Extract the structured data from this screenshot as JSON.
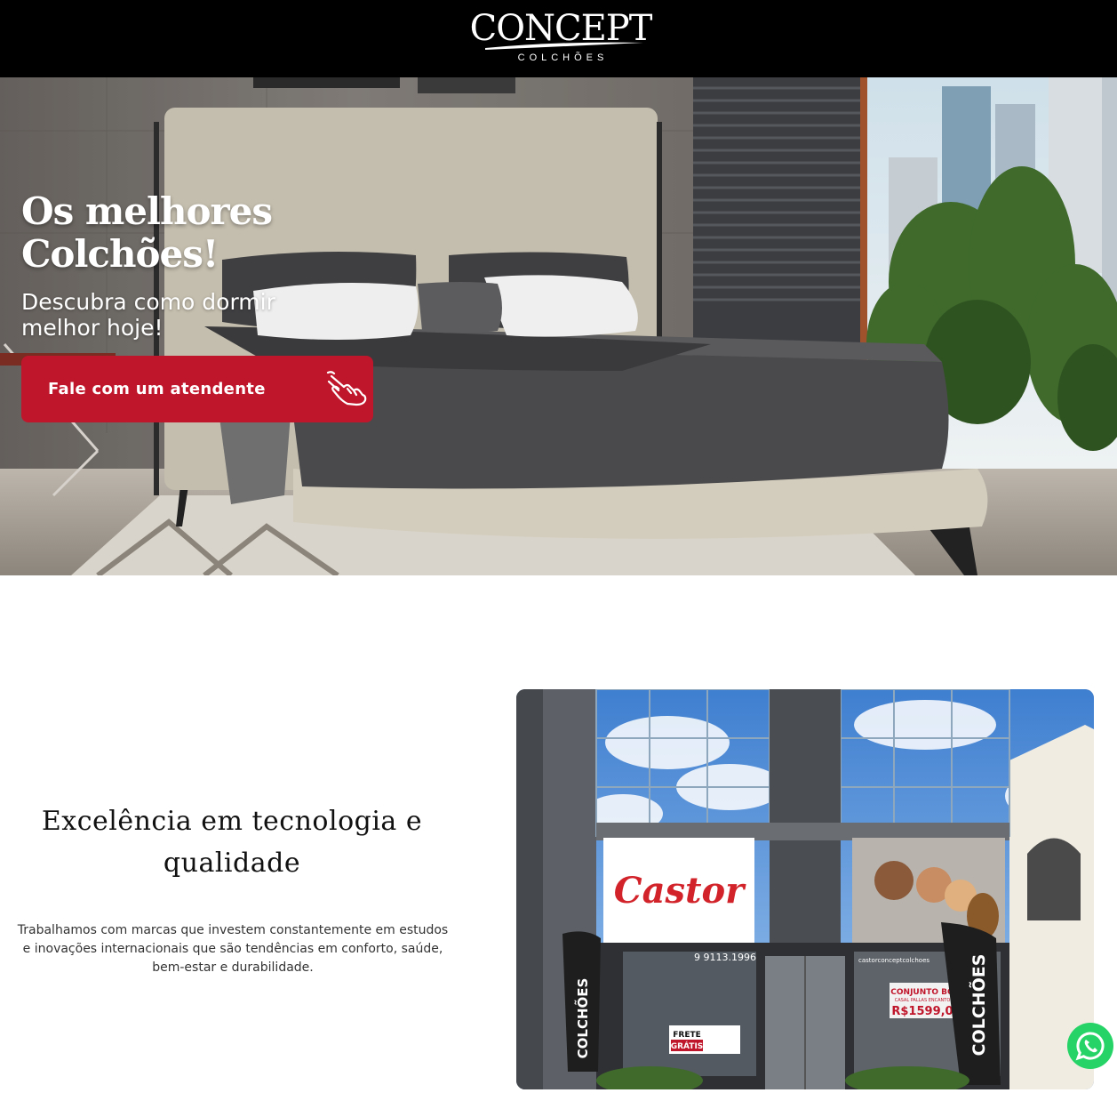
{
  "header": {
    "logo_main": "CONCEPT",
    "logo_sub": "COLCHÕES"
  },
  "hero": {
    "title": "Os melhores Colchões!",
    "subtitle": "Descubra como dormir melhor hoje!",
    "cta_label": "Fale com um atendente",
    "cta_icon": "hand-pointer-icon"
  },
  "section": {
    "title": "Excelência em tecnologia e qualidade",
    "text": "Trabalhamos com marcas que investem constantemente em estudos e inovações internacionais que são tendências em conforto, saúde, bem-estar e durabilidade."
  },
  "store": {
    "brand_sign": "Castor",
    "banner_left": "COLCHÕES",
    "banner_right": "COLCHÕES",
    "phone": "9 9113.1996",
    "frete": "FRETE",
    "gratis": "GRÁTIS",
    "promo_title": "CONJUNTO BO",
    "promo_sub": "CASAL PALLAS ENCANTO",
    "promo_price": "R$1599,0",
    "social": "castorconceptcolchoes"
  },
  "whatsapp": {
    "icon": "whatsapp-icon"
  },
  "colors": {
    "header_bg": "#000000",
    "accent_red": "#c0162b",
    "whatsapp_green": "#25d366"
  }
}
